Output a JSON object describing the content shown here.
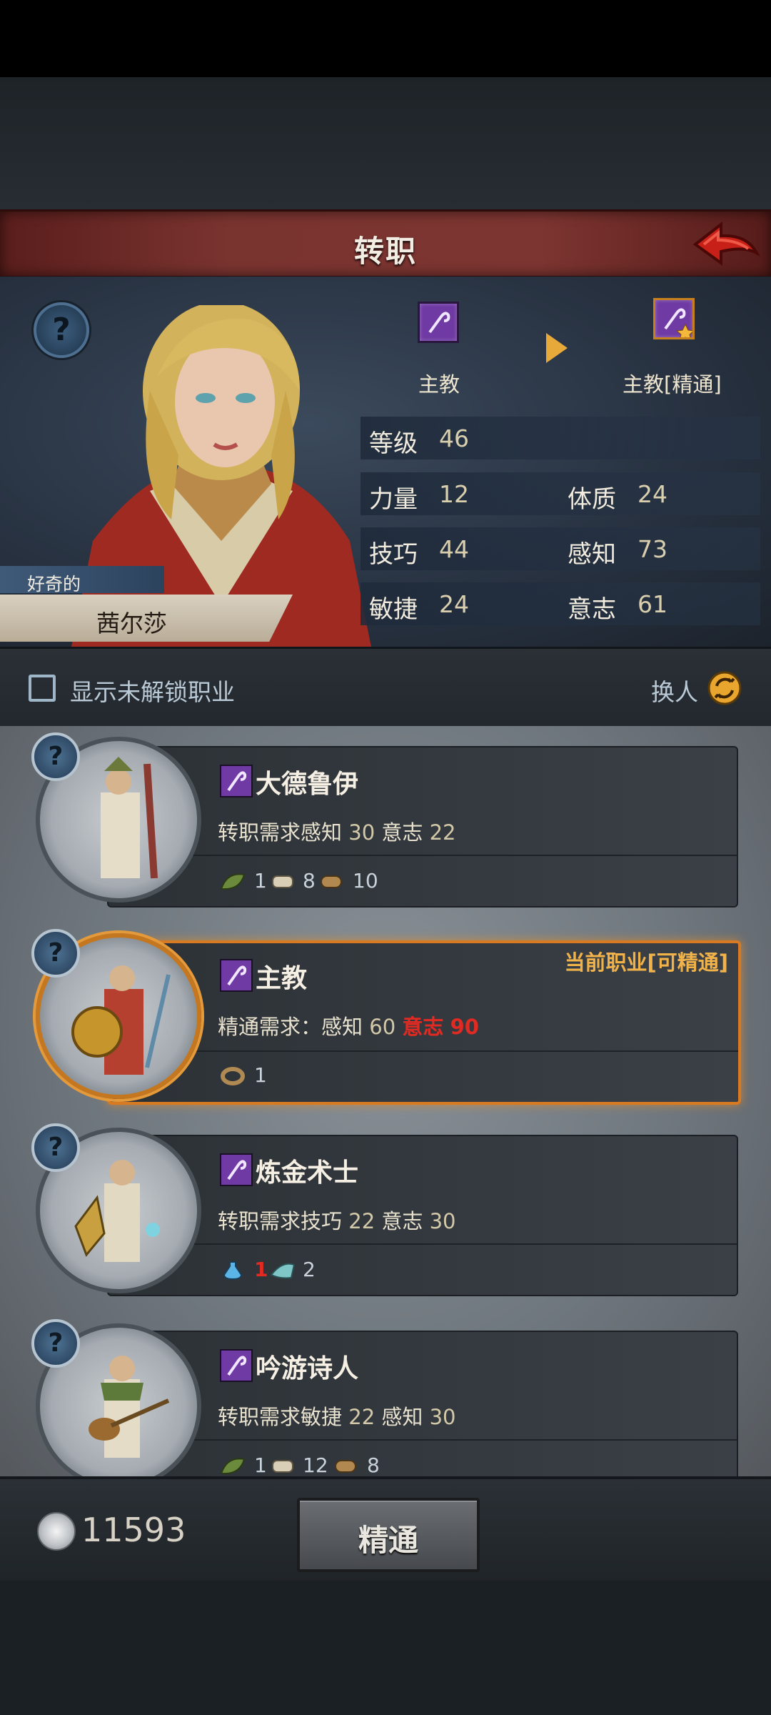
{
  "header": {
    "title": "转职"
  },
  "character": {
    "trait": "好奇的",
    "name": "茜尔莎",
    "current_class": "主教",
    "target_class": "主教[精通]",
    "stats": [
      {
        "label": "等级",
        "value": "46"
      },
      {
        "label": "力量",
        "value": "12"
      },
      {
        "label": "体质",
        "value": "24"
      },
      {
        "label": "技巧",
        "value": "44"
      },
      {
        "label": "感知",
        "value": "73"
      },
      {
        "label": "敏捷",
        "value": "24"
      },
      {
        "label": "意志",
        "value": "61"
      }
    ]
  },
  "filter": {
    "show_locked_label": "显示未解锁职业",
    "swap_label": "换人"
  },
  "jobs": [
    {
      "name": "大德鲁伊",
      "req_prefix": "转职需求",
      "req": [
        {
          "stat": "感知",
          "value": "30"
        },
        {
          "stat": "意志",
          "value": "22"
        }
      ],
      "materials": [
        {
          "icon": "leaf-icon",
          "count": "1"
        },
        {
          "icon": "scroll-icon",
          "count": "8"
        },
        {
          "icon": "wood-log-icon",
          "count": "10"
        }
      ]
    },
    {
      "name": "主教",
      "tag": "当前职业[可精通]",
      "req_prefix": "精通需求：",
      "req": [
        {
          "stat": "感知",
          "value": "60"
        },
        {
          "stat": "意志",
          "value": "90"
        }
      ],
      "materials": [
        {
          "icon": "ring-icon",
          "count": "1"
        }
      ]
    },
    {
      "name": "炼金术士",
      "req_prefix": "转职需求",
      "req": [
        {
          "stat": "技巧",
          "value": "22"
        },
        {
          "stat": "意志",
          "value": "30"
        }
      ],
      "materials": [
        {
          "icon": "potion-icon",
          "count": "1"
        },
        {
          "icon": "cloth-icon",
          "count": "2"
        }
      ]
    },
    {
      "name": "吟游诗人",
      "req_prefix": "转职需求",
      "req": [
        {
          "stat": "敏捷",
          "value": "22"
        },
        {
          "stat": "感知",
          "value": "30"
        }
      ],
      "materials": [
        {
          "icon": "leaf-icon",
          "count": "1"
        },
        {
          "icon": "scroll-icon",
          "count": "12"
        },
        {
          "icon": "wood-log-icon",
          "count": "8"
        }
      ]
    }
  ],
  "footer": {
    "coins": "11593",
    "master_button": "精通"
  },
  "colors": {
    "accent_orange": "#d77a21",
    "class_purple": "#6f3aa3",
    "warning_red": "#e02a22"
  }
}
